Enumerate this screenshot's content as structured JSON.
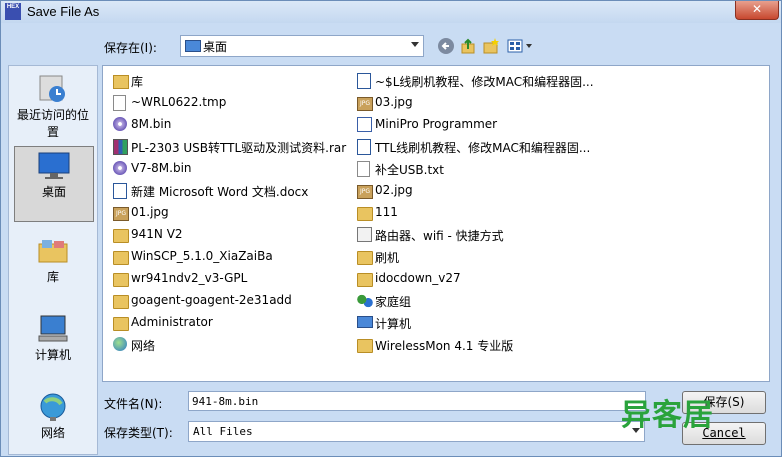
{
  "window": {
    "title": "Save File As",
    "app_icon_text": "HEX",
    "close_label": "✕"
  },
  "toolbar": {
    "save_in_label": "保存在(I):",
    "location": "桌面",
    "icons": [
      "back-arrow-icon",
      "up-folder-icon",
      "new-folder-icon",
      "view-menu-icon"
    ]
  },
  "places": [
    {
      "label": "最近访问的位置",
      "icon": "recent-places-icon"
    },
    {
      "label": "桌面",
      "icon": "desktop-icon",
      "selected": true
    },
    {
      "label": "库",
      "icon": "libraries-icon"
    },
    {
      "label": "计算机",
      "icon": "computer-icon"
    },
    {
      "label": "网络",
      "icon": "network-icon"
    }
  ],
  "files": [
    {
      "name": "库",
      "icon": "library-folder"
    },
    {
      "name": "~WRL0622.tmp",
      "icon": "doc"
    },
    {
      "name": "8M.bin",
      "icon": "disc"
    },
    {
      "name": "PL-2303 USB转TTL驱动及测试资料.rar",
      "icon": "rar"
    },
    {
      "name": "V7-8M.bin",
      "icon": "disc"
    },
    {
      "name": "新建 Microsoft Word 文档.docx",
      "icon": "word"
    },
    {
      "name": "01.jpg",
      "icon": "jpg"
    },
    {
      "name": "941N V2",
      "icon": "folder"
    },
    {
      "name": "WinSCP_5.1.0_XiaZaiBa",
      "icon": "folder"
    },
    {
      "name": "wr941ndv2_v3-GPL",
      "icon": "folder"
    },
    {
      "name": "goagent-goagent-2e31add",
      "icon": "folder"
    },
    {
      "name": "Administrator",
      "icon": "folder"
    },
    {
      "name": "网络",
      "icon": "network"
    },
    {
      "name": "~$L线刷机教程、修改MAC和编程器固...",
      "icon": "word"
    },
    {
      "name": "03.jpg",
      "icon": "jpg"
    },
    {
      "name": "MiniPro Programmer",
      "icon": "app"
    },
    {
      "name": "TTL线刷机教程、修改MAC和编程器固...",
      "icon": "word"
    },
    {
      "name": "补全USB.txt",
      "icon": "doc"
    },
    {
      "name": "02.jpg",
      "icon": "jpg"
    },
    {
      "name": "111",
      "icon": "folder"
    },
    {
      "name": "路由器、wifi - 快捷方式",
      "icon": "link"
    },
    {
      "name": "刷机",
      "icon": "folder"
    },
    {
      "name": "idocdown_v27",
      "icon": "folder"
    },
    {
      "name": "家庭组",
      "icon": "group"
    },
    {
      "name": "计算机",
      "icon": "pc"
    },
    {
      "name": "WirelessMon 4.1 专业版",
      "icon": "folder"
    }
  ],
  "filename": {
    "label": "文件名(N):",
    "value": "941-8m.bin"
  },
  "filetype": {
    "label": "保存类型(T):",
    "value": "All Files"
  },
  "buttons": {
    "save": "保存(S)",
    "cancel": "Cancel"
  },
  "watermark": "异客居"
}
